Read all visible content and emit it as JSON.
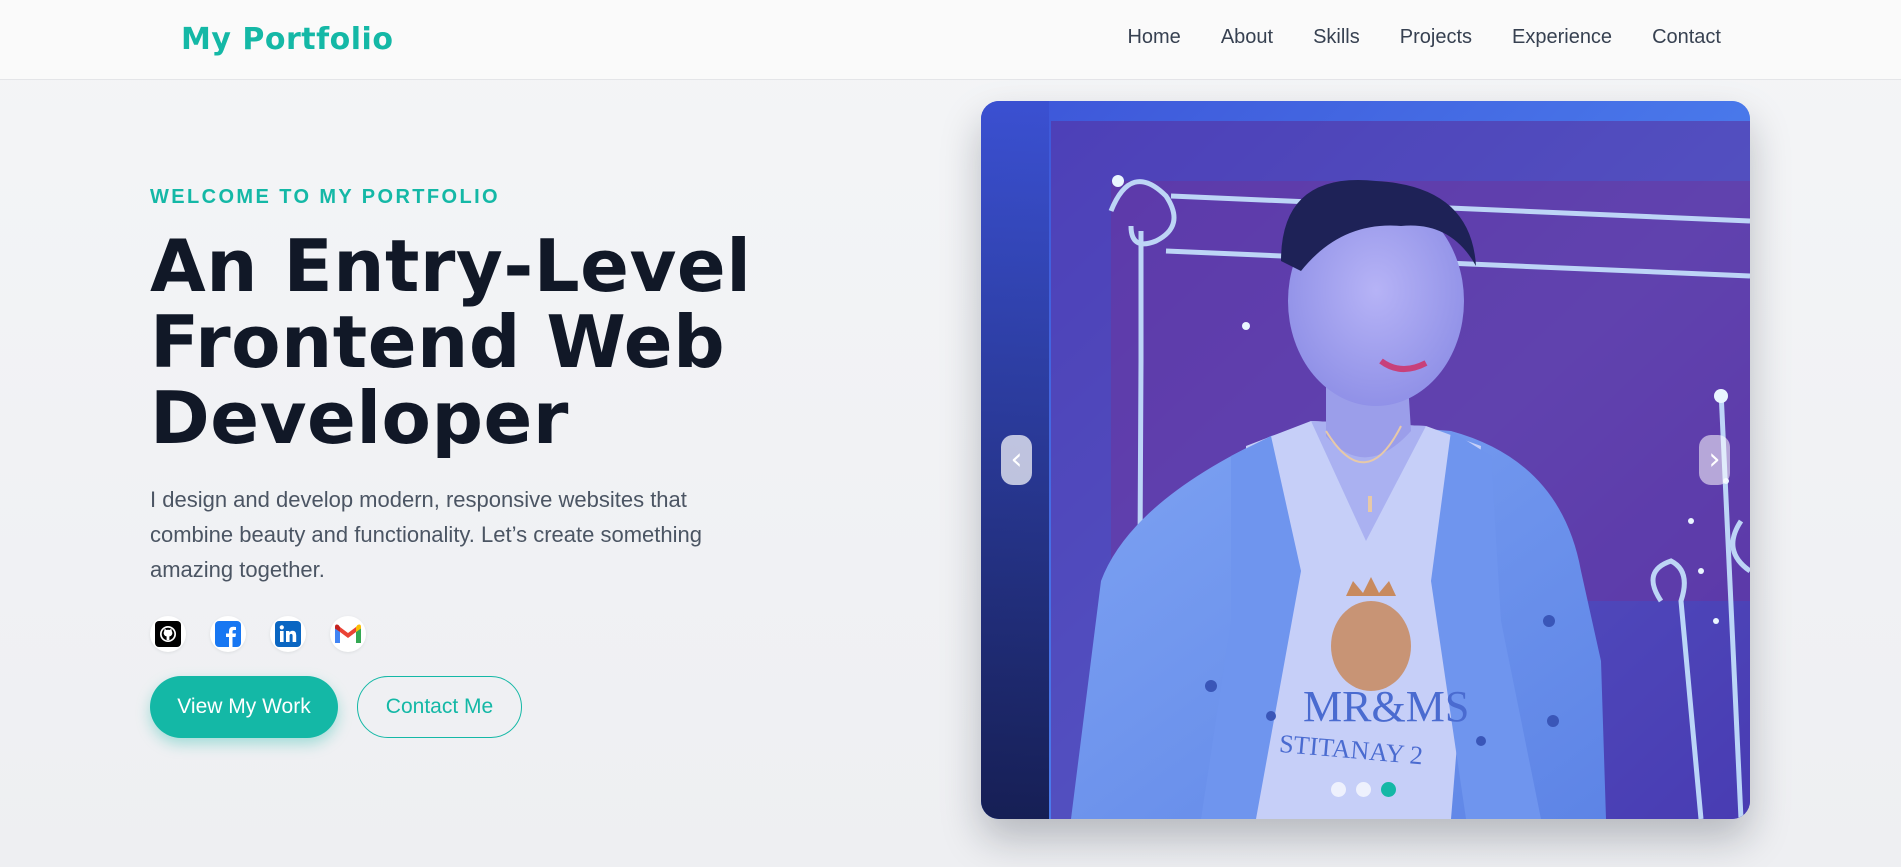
{
  "nav": {
    "brand": "My Portfolio",
    "links": [
      {
        "label": "Home"
      },
      {
        "label": "About"
      },
      {
        "label": "Skills"
      },
      {
        "label": "Projects"
      },
      {
        "label": "Experience"
      },
      {
        "label": "Contact"
      }
    ]
  },
  "hero": {
    "eyebrow": "WELCOME TO MY PORTFOLIO",
    "headline_lines": [
      "An Entry-Level",
      "Frontend Web",
      "Developer"
    ],
    "description": "I design and develop modern, responsive websites that combine beauty and functionality. Let’s create something amazing together.",
    "socials": [
      {
        "icon": "github-icon"
      },
      {
        "icon": "facebook-icon"
      },
      {
        "icon": "linkedin-icon"
      },
      {
        "icon": "gmail-icon"
      }
    ],
    "primary_button": "View My Work",
    "secondary_button": "Contact Me"
  },
  "carousel": {
    "prev_icon": "‹",
    "next_icon": "›",
    "slide_count": 3,
    "active_slide": 3,
    "shirt_text_top": "MR&MS",
    "shirt_text_bottom": "STITANAY 2"
  },
  "colors": {
    "accent": "#14b8a6",
    "heading": "#111827",
    "body_text": "#4b5563",
    "nav_text": "#374151",
    "background": "#f1f2f5"
  }
}
